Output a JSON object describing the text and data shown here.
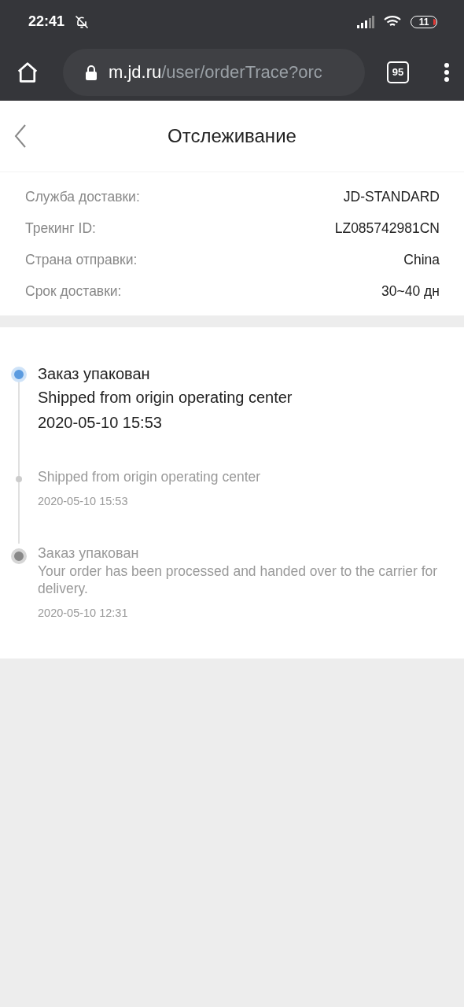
{
  "status_bar": {
    "time": "22:41",
    "battery": "11"
  },
  "browser": {
    "url_host": "m.jd.ru",
    "url_path": "/user/orderTrace?orc",
    "tab_count": "95"
  },
  "header": {
    "title": "Отслеживание"
  },
  "info": [
    {
      "label": "Служба доставки:",
      "value": "JD-STANDARD"
    },
    {
      "label": "Трекинг ID:",
      "value": "LZ085742981CN"
    },
    {
      "label": "Страна отправки:",
      "value": "China"
    },
    {
      "label": "Срок доставки:",
      "value": "30~40 дн"
    }
  ],
  "timeline": [
    {
      "kind": "current",
      "title": "Заказ упакован",
      "description": "Shipped from origin operating center",
      "time": "2020-05-10 15:53"
    },
    {
      "kind": "minor",
      "description": "Shipped from origin operating center",
      "time": "2020-05-10 15:53"
    },
    {
      "kind": "end",
      "title": "Заказ упакован",
      "description": "Your order has been processed and handed over to the carrier for delivery.",
      "time": "2020-05-10 12:31"
    }
  ]
}
